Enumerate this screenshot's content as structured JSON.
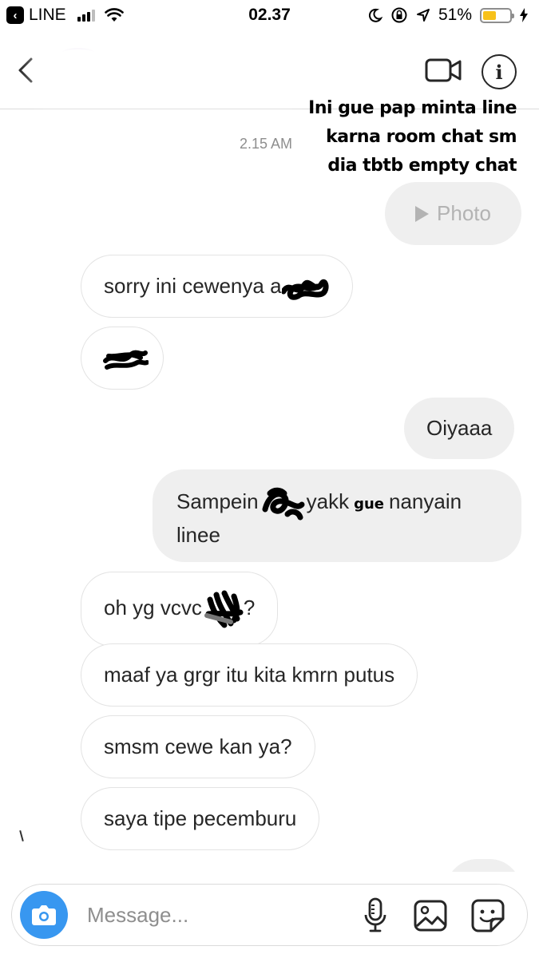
{
  "status_bar": {
    "back_app": "LINE",
    "time": "02.37",
    "battery_pct": "51%",
    "battery_level": 0.51
  },
  "header": {
    "icons": [
      "chevron-left-icon",
      "video-camera-icon",
      "info-icon"
    ]
  },
  "annotation": {
    "lines": [
      "Ini gue pap minta line",
      "karna room chat sm",
      "dia tbtb empty chat"
    ]
  },
  "chat": {
    "timestamp": "2.15 AM",
    "photo_label": "Photo",
    "messages": [
      {
        "side": "in",
        "text": "sorry ini cewenya a"
      },
      {
        "side": "in",
        "text": ""
      },
      {
        "side": "out",
        "text": "Oiyaaa"
      },
      {
        "side": "out",
        "text_a": "Sampein",
        "text_b": "yakk",
        "label": "gue",
        "text_c": "nanyain",
        "text_d": "linee"
      },
      {
        "side": "in",
        "text": "oh yg vcvc",
        "suffix": "?"
      },
      {
        "side": "in",
        "text": "maaf ya grgr itu kita kmrn putus"
      },
      {
        "side": "in",
        "text": "smsm cewe kan ya?"
      },
      {
        "side": "in",
        "text": "saya tipe pecemburu"
      }
    ]
  },
  "composer": {
    "placeholder": "Message...",
    "icons": [
      "camera-icon",
      "microphone-icon",
      "gallery-icon",
      "sticker-icon"
    ],
    "accent": "#3897f0"
  }
}
